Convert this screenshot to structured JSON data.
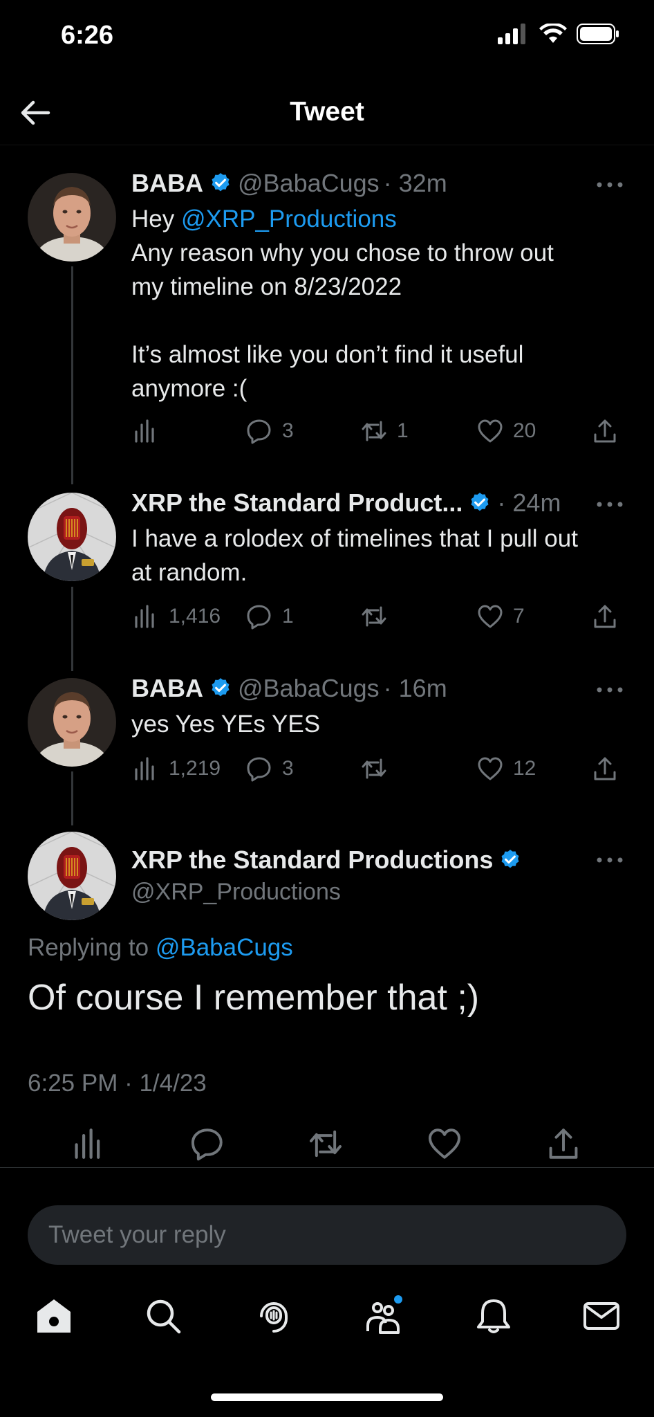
{
  "status_bar": {
    "time": "6:26"
  },
  "header": {
    "title": "Tweet"
  },
  "tweets": [
    {
      "name": "BABA",
      "handle": "@BabaCugs",
      "time": "· 32m",
      "line1_prefix": "Hey ",
      "mention": "@XRP_Productions",
      "lines": [
        "Any reason why you chose to throw out",
        "my timeline on 8/23/2022",
        "",
        "It’s almost like you don’t find it useful",
        "anymore :("
      ],
      "views": "",
      "replies": "3",
      "retweets": "1",
      "likes": "20"
    },
    {
      "name": "XRP the Standard Product...",
      "handle": "",
      "time": "· 24m",
      "lines": [
        "I have a rolodex of timelines that I pull out",
        "at random."
      ],
      "views": "1,416",
      "replies": "1",
      "retweets": "",
      "likes": "7"
    },
    {
      "name": "BABA",
      "handle": "@BabaCugs",
      "time": "· 16m",
      "lines": [
        "yes Yes YEs YES"
      ],
      "views": "1,219",
      "replies": "3",
      "retweets": "",
      "likes": "12"
    }
  ],
  "main_tweet": {
    "name": "XRP the Standard Productions",
    "handle": "@XRP_Productions",
    "replying_prefix": "Replying to ",
    "replying_to": "@BabaCugs",
    "text": "Of course I remember that ;)",
    "timestamp": "6:25 PM · 1/4/23"
  },
  "reply": {
    "placeholder": "Tweet your reply"
  },
  "colors": {
    "accent": "#1d9bf0",
    "muted": "#71767b",
    "background": "#000000"
  },
  "icons": [
    "back-arrow-icon",
    "verified-badge-icon",
    "more-icon",
    "views-icon",
    "reply-icon",
    "retweet-icon",
    "like-icon",
    "share-icon",
    "home-icon",
    "search-icon",
    "spaces-icon",
    "communities-icon",
    "notifications-icon",
    "messages-icon"
  ]
}
